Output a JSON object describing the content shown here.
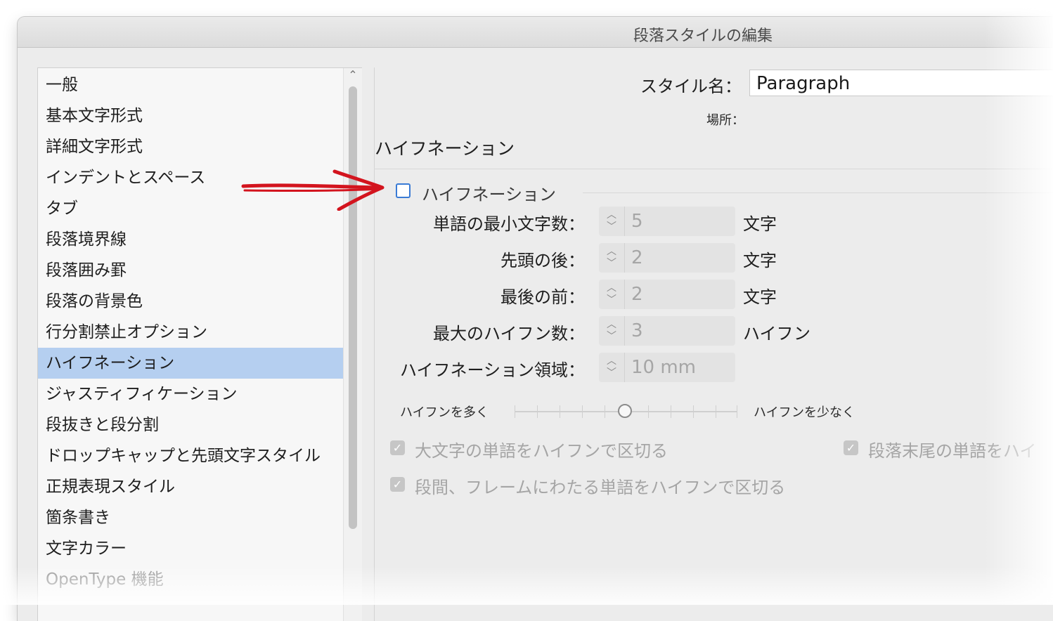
{
  "window": {
    "title": "段落スタイルの編集"
  },
  "sidebar": {
    "items": [
      {
        "label": "一般"
      },
      {
        "label": "基本文字形式"
      },
      {
        "label": "詳細文字形式"
      },
      {
        "label": "インデントとスペース"
      },
      {
        "label": "タブ"
      },
      {
        "label": "段落境界線"
      },
      {
        "label": "段落囲み罫"
      },
      {
        "label": "段落の背景色"
      },
      {
        "label": "行分割禁止オプション"
      },
      {
        "label": "ハイフネーション",
        "selected": true
      },
      {
        "label": "ジャスティフィケーション"
      },
      {
        "label": "段抜きと段分割"
      },
      {
        "label": "ドロップキャップと先頭文字スタイル"
      },
      {
        "label": "正規表現スタイル"
      },
      {
        "label": "箇条書き"
      },
      {
        "label": "文字カラー"
      },
      {
        "label": "OpenType 機能"
      }
    ],
    "scroll_up_icon": "chevron-up-icon"
  },
  "header": {
    "style_name_label": "スタイル名：",
    "style_name_value": "Paragraph",
    "location_label": "場所："
  },
  "section": {
    "title": "ハイフネーション",
    "hyphenation_checkbox_label": "ハイフネーション",
    "hyphenation_checked": false
  },
  "fields": [
    {
      "label": "単語の最小文字数：",
      "value": "5",
      "unit": "文字"
    },
    {
      "label": "先頭の後：",
      "value": "2",
      "unit": "文字"
    },
    {
      "label": "最後の前：",
      "value": "2",
      "unit": "文字"
    },
    {
      "label": "最大のハイフン数：",
      "value": "3",
      "unit": "ハイフン"
    },
    {
      "label": "ハイフネーション領域：",
      "value": "10 mm",
      "unit": ""
    }
  ],
  "slider": {
    "left_label": "ハイフンを多く",
    "right_label": "ハイフンを少なく",
    "position_fraction": 0.5
  },
  "options": [
    {
      "label": "大文字の単語をハイフンで区切る",
      "checked": true
    },
    {
      "label": "段落末尾の単語をハイ",
      "checked": true
    },
    {
      "label": "段間、フレームにわたる単語をハイフンで区切る",
      "checked": true
    }
  ],
  "colors": {
    "selection": "#b5cff0",
    "annotation_arrow": "#d3141e",
    "checkbox_border": "#3a7bd5"
  }
}
